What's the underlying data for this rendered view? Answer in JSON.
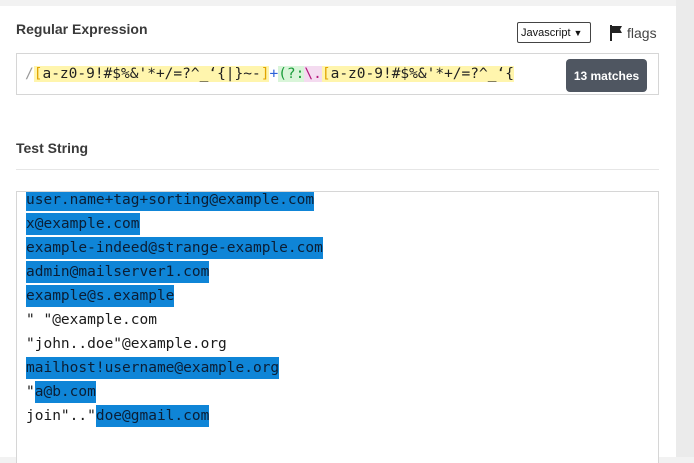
{
  "regex_section": {
    "title": "Regular Expression",
    "flavor": "Javascript",
    "flags_label": "flags",
    "pattern_parts": [
      {
        "t": "/",
        "k": "delim"
      },
      {
        "t": "[",
        "k": "br-cls"
      },
      {
        "t": "a-z0-9!#$%&'*+/=?^_‘{|}~-",
        "k": "cls"
      },
      {
        "t": "]",
        "k": "br-cls"
      },
      {
        "t": "+",
        "k": "op"
      },
      {
        "t": "(?:",
        "k": "grp"
      },
      {
        "t": "\\.",
        "k": "esc"
      },
      {
        "t": "[",
        "k": "br-cls"
      },
      {
        "t": "a-z0-9!#$%&'*+/=?^_‘{",
        "k": "cls"
      }
    ],
    "matches_label": "13 matches"
  },
  "test_section": {
    "title": "Test String",
    "lines": [
      [
        {
          "t": "user.name+tag+sorting@example.com",
          "m": true
        }
      ],
      [
        {
          "t": "x@example.com",
          "m": true
        }
      ],
      [
        {
          "t": "example-indeed@strange-example.com",
          "m": true
        }
      ],
      [
        {
          "t": "admin@mailserver1.com",
          "m": true
        }
      ],
      [
        {
          "t": "example@s.example",
          "m": true
        }
      ],
      [
        {
          "t": "\" \"@example.com",
          "m": false
        }
      ],
      [
        {
          "t": "\"john..doe\"@example.org",
          "m": false
        }
      ],
      [
        {
          "t": "mailhost!username@example.org",
          "m": true
        }
      ],
      [
        {
          "t": "\"",
          "m": false
        },
        {
          "t": "a@b.com",
          "m": true
        }
      ],
      [
        {
          "t": "join\"..\"",
          "m": false
        },
        {
          "t": "doe@gmail.com",
          "m": true
        }
      ]
    ]
  },
  "colors": {
    "match_highlight": "#0f85d7",
    "matches_badge": "#4f5661"
  }
}
